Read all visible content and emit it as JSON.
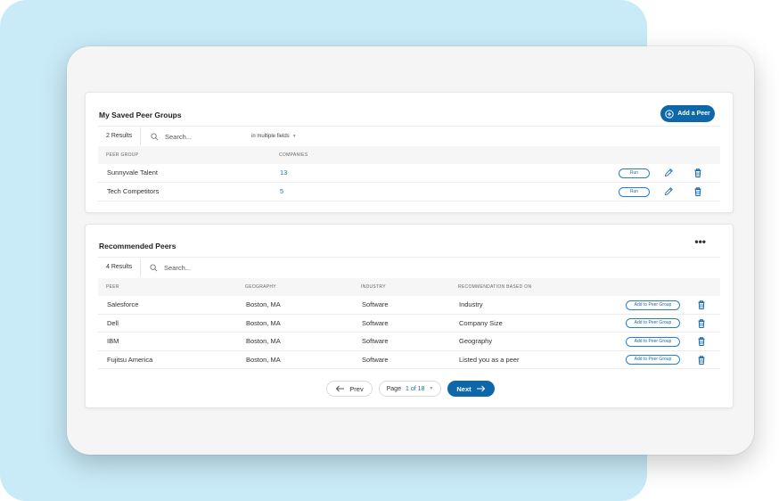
{
  "saved_groups": {
    "title": "My Saved Peer Groups",
    "add_button_label": "Add a Peer",
    "results_count": "2 Results",
    "search_placeholder": "Search...",
    "search_scope": "in multiple fields",
    "columns": [
      "PEER GROUP",
      "COMPANIES"
    ],
    "rows": [
      {
        "name": "Sunnyvale Talent",
        "companies": "13",
        "action_label": "Run"
      },
      {
        "name": "Tech Competitors",
        "companies": "5",
        "action_label": "Run"
      }
    ]
  },
  "recommended": {
    "title": "Recommended Peers",
    "more_label": "•••",
    "results_count": "4 Results",
    "search_placeholder": "Search...",
    "columns": [
      "PEER",
      "GEOGRAPHY",
      "INDUSTRY",
      "RECOMMENDATION BASED ON"
    ],
    "rows": [
      {
        "peer": "Salesforce",
        "geography": "Boston, MA",
        "industry": "Software",
        "reason": "Industry",
        "action_label": "Add to Peer Group"
      },
      {
        "peer": "Dell",
        "geography": "Boston, MA",
        "industry": "Software",
        "reason": "Company Size",
        "action_label": "Add to Peer Group"
      },
      {
        "peer": "IBM",
        "geography": "Boston, MA",
        "industry": "Software",
        "reason": "Geography",
        "action_label": "Add to Peer Group"
      },
      {
        "peer": "Fujitsu America",
        "geography": "Boston, MA",
        "industry": "Software",
        "reason": "Listed you as a peer",
        "action_label": "Add to Peer Group"
      }
    ]
  },
  "pagination": {
    "prev_label": "Prev",
    "page_prefix": "Page",
    "current_page": "1",
    "of_total": "of 18",
    "next_label": "Next"
  },
  "icons": {
    "search": "search-icon",
    "edit": "pencil-icon",
    "delete": "trash-icon",
    "add": "plus-circle-icon",
    "prev": "arrow-left-icon",
    "next": "arrow-right-icon",
    "dropdown": "chevron-down-icon"
  },
  "colors": {
    "accent": "#0e67a8",
    "link": "#1a73b8",
    "background_panel": "#c9ebf8"
  }
}
